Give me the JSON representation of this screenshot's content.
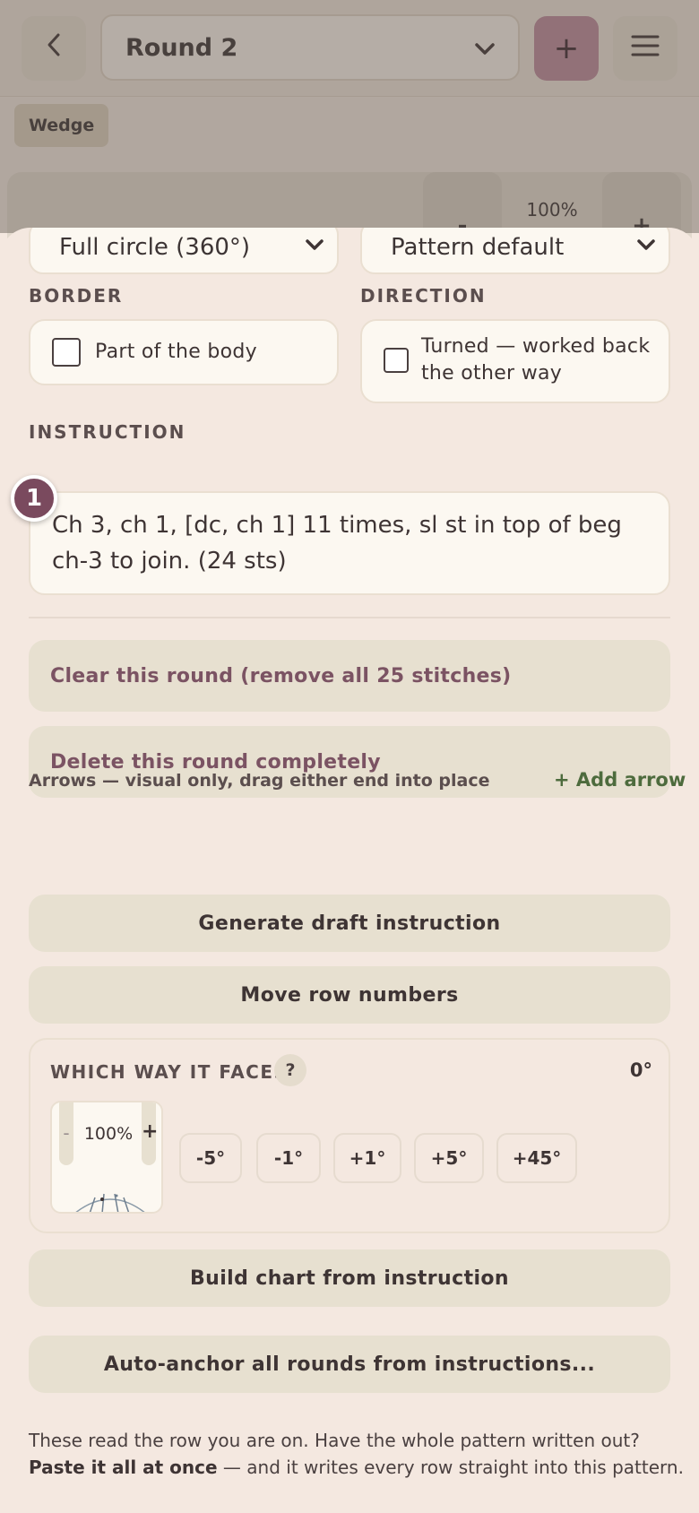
{
  "background": {
    "round_select": "Round 2",
    "tag": "Wedge",
    "zoom_minus": "-",
    "zoom_value": "100%",
    "zoom_plus": "+",
    "add_label": "+"
  },
  "sheet": {
    "span_select": "Full circle (360°)",
    "style_select": "Pattern default",
    "border_label": "BORDER",
    "border_checkbox": "Part of the body",
    "direction_label": "DIRECTION",
    "direction_checkbox_line1": "Turned — worked back",
    "direction_checkbox_line2": "the other way",
    "instruction_label": "INSTRUCTION",
    "instruction_badge": "1",
    "instruction_text": "Ch 3, ch 1, [dc, ch 1] 11 times, sl st in top of beg ch-3 to join. (24 sts)",
    "clear_round": "Clear this round (remove all 25 stitches)",
    "delete_round": "Delete this round completely",
    "arrows_note": "Arrows — visual only, drag either end into place",
    "add_arrow": "+ Add arrow",
    "generate_draft": "Generate draft instruction",
    "move_row_numbers": "Move row numbers",
    "faces": {
      "label": "WHICH WAY IT FACES",
      "help": "?",
      "value": "0°",
      "mini_minus": "-",
      "mini_zoom": "100%",
      "mini_plus": "+",
      "steps": [
        "-5°",
        "-1°",
        "+1°",
        "+5°",
        "+45°"
      ]
    },
    "build_chart": "Build chart from instruction",
    "auto_anchor": "Auto-anchor all rounds from instructions...",
    "footer_line1": "These read the row you are on. Have the whole pattern written out?",
    "footer_bold": "Paste it all at once",
    "footer_rest": " — and it writes every row straight into this pattern."
  },
  "colors": {
    "accent": "#7a4a5e",
    "add_arrow": "#4d6b3d",
    "sheet_bg": "#f4e8e0"
  }
}
